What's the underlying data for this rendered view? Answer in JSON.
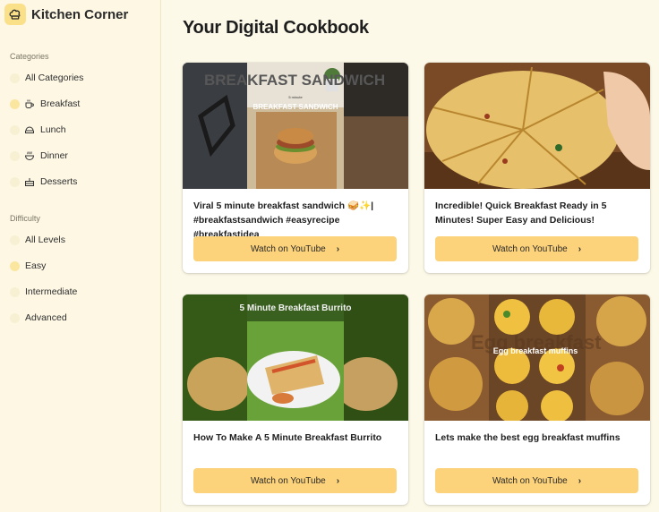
{
  "app": {
    "title": "Kitchen Corner",
    "logo_icon": "chef-hat-icon"
  },
  "sidebar": {
    "categories_title": "Categories",
    "categories": [
      {
        "label": "All Categories",
        "icon": "",
        "active": false
      },
      {
        "label": "Breakfast",
        "icon": "coffee-cup-icon",
        "active": true
      },
      {
        "label": "Lunch",
        "icon": "lunch-box-icon",
        "active": false
      },
      {
        "label": "Dinner",
        "icon": "soup-bowl-icon",
        "active": false
      },
      {
        "label": "Desserts",
        "icon": "cake-icon",
        "active": false
      }
    ],
    "difficulty_title": "Difficulty",
    "difficulty": [
      {
        "label": "All Levels",
        "active": false
      },
      {
        "label": "Easy",
        "active": true
      },
      {
        "label": "Intermediate",
        "active": false
      },
      {
        "label": "Advanced",
        "active": false
      }
    ]
  },
  "main": {
    "title": "Your Digital Cookbook",
    "cards": [
      {
        "title": "Viral 5 minute breakfast sandwich 🥪✨| #breakfastsandwich #easyrecipe #breakfastidea",
        "button_label": "Watch on YouTube",
        "thumb_text_top": "5 minute",
        "thumb_text": "BREAKFAST SANDWICH",
        "thumb_bg_text": "BREAKFAST SANDWICH"
      },
      {
        "title": "Incredible! Quick Breakfast Ready in 5 Minutes! Super Easy and Delicious!",
        "button_label": "Watch on YouTube"
      },
      {
        "title": "How To Make A 5 Minute Breakfast Burrito",
        "button_label": "Watch on YouTube",
        "thumb_text": "5 Minute Breakfast Burrito"
      },
      {
        "title": "Lets make the best egg breakfast muffins",
        "button_label": "Watch on YouTube",
        "thumb_text": "Egg breakfast muffins",
        "thumb_bg_text": "Egg breakfast"
      }
    ]
  },
  "colors": {
    "accent": "#fcd27a",
    "sidebar_bg": "#fdf7e4",
    "page_bg": "#fdf9e8"
  }
}
